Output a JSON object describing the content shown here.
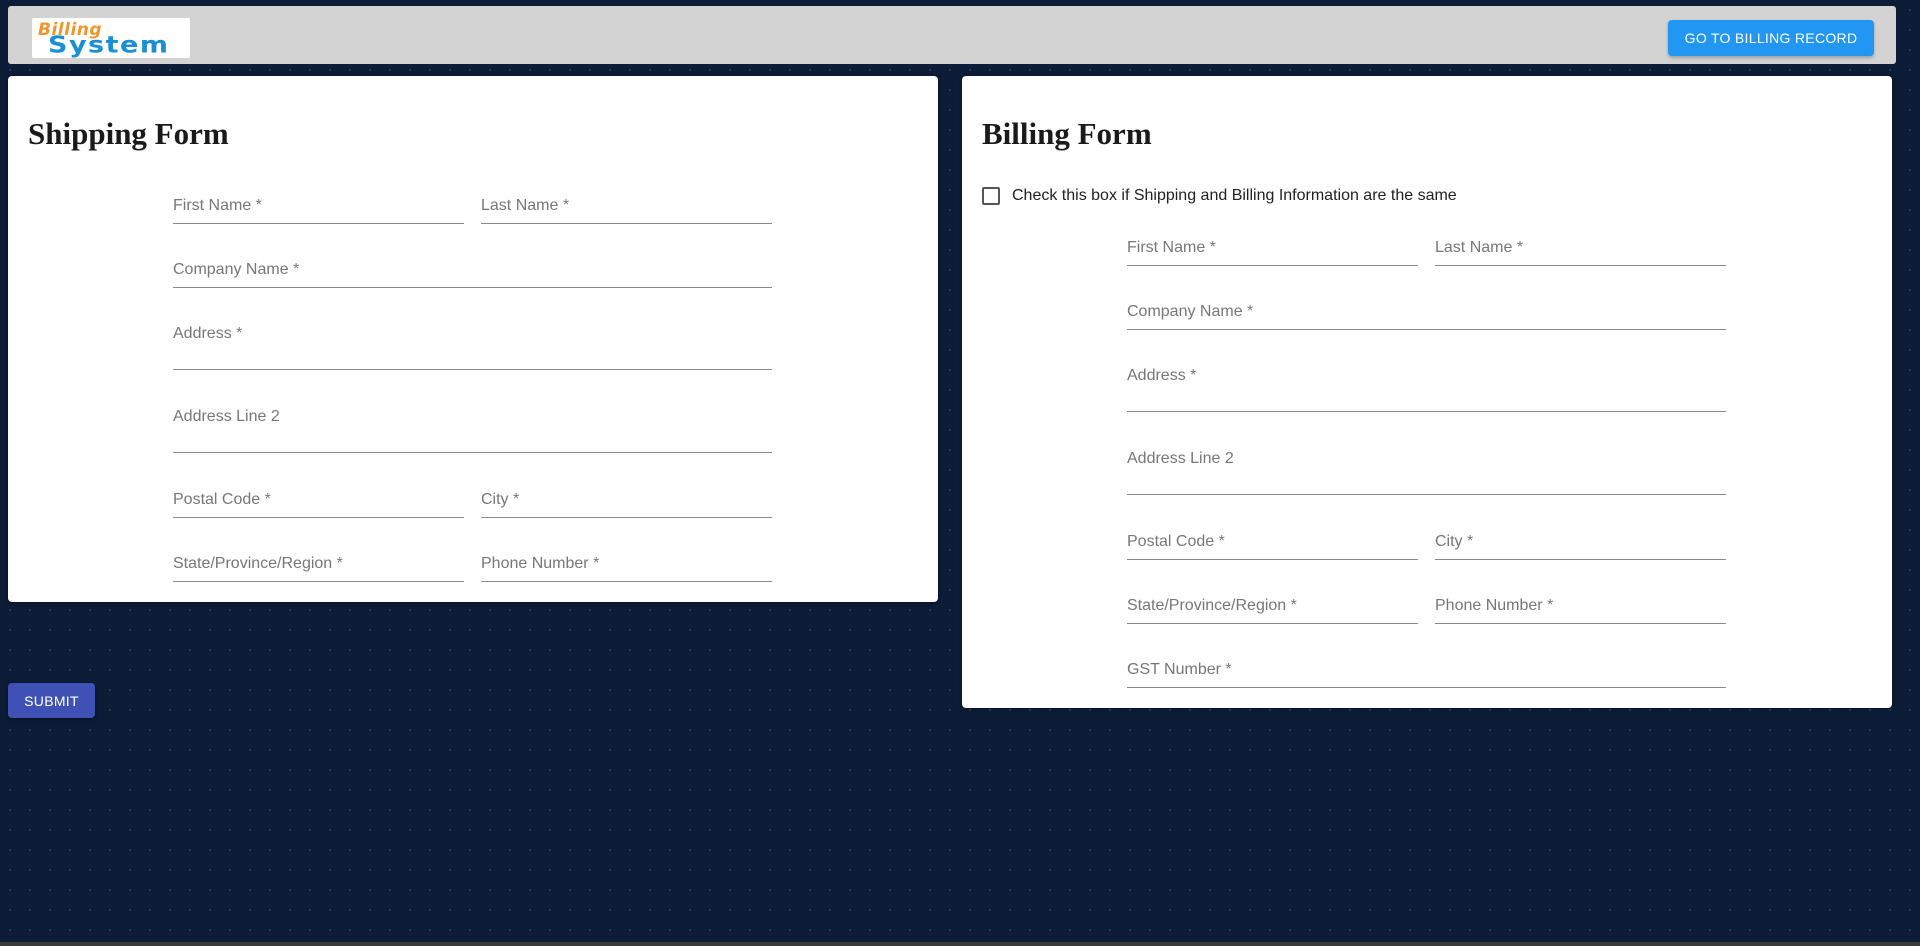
{
  "header": {
    "logo_top": "Billing",
    "logo_bottom": "System",
    "billing_record_button": "GO TO BILLING RECORD"
  },
  "shipping_form": {
    "title": "Shipping Form",
    "fields": {
      "first_name": "First Name *",
      "last_name": "Last Name *",
      "company_name": "Company Name *",
      "address": "Address *",
      "address_line_2": "Address Line 2",
      "postal_code": "Postal Code *",
      "city": "City *",
      "state": "State/Province/Region *",
      "phone": "Phone Number *"
    }
  },
  "billing_form": {
    "title": "Billing Form",
    "same_as_shipping": "Check this box if Shipping and Billing Information are the same",
    "fields": {
      "first_name": "First Name *",
      "last_name": "Last Name *",
      "company_name": "Company Name *",
      "address": "Address *",
      "address_line_2": "Address Line 2",
      "postal_code": "Postal Code *",
      "city": "City *",
      "state": "State/Province/Region *",
      "phone": "Phone Number *",
      "gst": "GST Number *"
    }
  },
  "submit_button": "SUBMIT",
  "colors": {
    "background": "#0c1b36",
    "header": "#d3d3d3",
    "primary_button": "#2196f3",
    "submit_button": "#3f51b5",
    "logo_orange": "#f0962b",
    "logo_blue": "#1a8fd6"
  }
}
